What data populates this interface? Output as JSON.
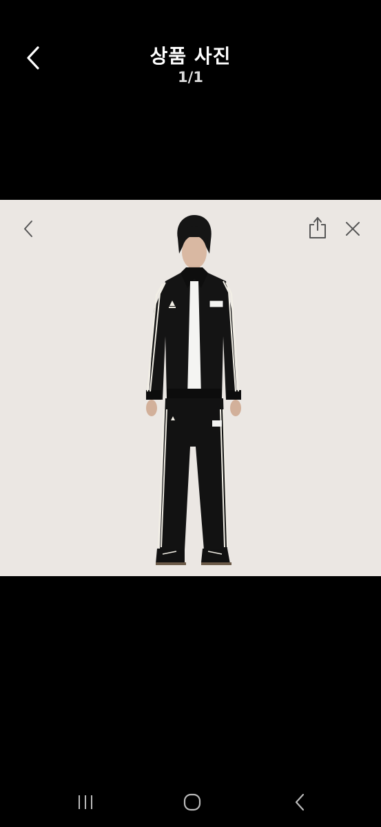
{
  "header": {
    "title": "상품 사진",
    "counter": "1/1"
  },
  "photo": {
    "background_color": "#ebe7e3",
    "garment_color": "#111111",
    "stripe_color": "#f2efe6",
    "logo_text": "adidas"
  },
  "icons": {
    "back": "chevron-left-icon",
    "photo_prev": "chevron-left-icon",
    "share": "share-icon",
    "close": "close-icon",
    "recent_apps": "recent-apps-icon",
    "home": "home-icon",
    "system_back": "back-icon"
  }
}
